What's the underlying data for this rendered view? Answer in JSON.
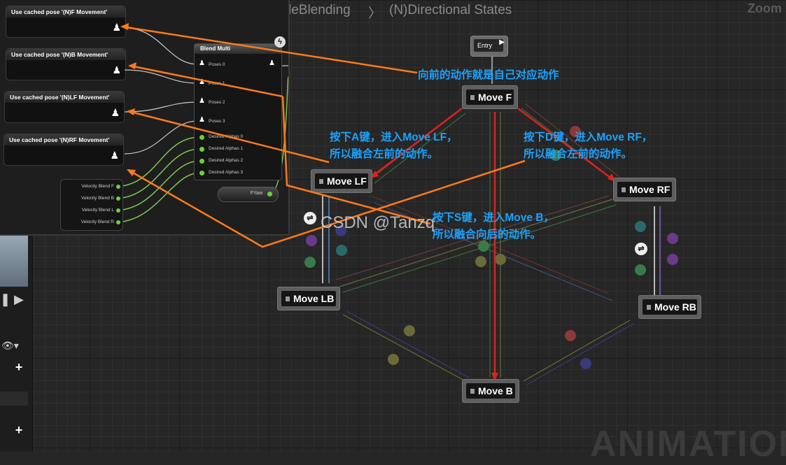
{
  "breadcrumb": {
    "parent": "leBlending",
    "separator": "〉",
    "current": "(N)Directional States",
    "zoom_label": "Zoom"
  },
  "background_watermark": "ANIMATION",
  "blend_panel": {
    "pose_nodes": [
      {
        "label": "Use cached pose '(N)F Movement'"
      },
      {
        "label": "Use cached pose '(N)B Movement'"
      },
      {
        "label": "Use cached pose '(N)LF Movement'"
      },
      {
        "label": "Use cached pose '(N)RF Movement'"
      }
    ],
    "blend_multi": {
      "title": "Blend Multi",
      "poses": [
        "Poses 0",
        "Poses 1",
        "Poses 2",
        "Poses 3"
      ],
      "alphas": [
        "Desired Alphas 0",
        "Desired Alphas 1",
        "Desired Alphas 2",
        "Desired Alphas 3"
      ]
    },
    "velocity_node": {
      "rows": [
        "Velocity Blend F",
        "Velocity Blend B",
        "Velocity Blend L",
        "Velocity Blend R"
      ]
    },
    "fyaw_label": "FYaw"
  },
  "state_machine": {
    "entry_label": "Entry",
    "states": {
      "move_f": "Move F",
      "move_lf": "Move LF",
      "move_rf": "Move RF",
      "move_lb": "Move LB",
      "move_rb": "Move RB",
      "move_b": "Move B"
    }
  },
  "annotations": {
    "forward": "向前的动作就是自己对应动作",
    "a_key_line1": "按下A键，进入Move LF，",
    "a_key_line2": "所以融合左前的动作。",
    "d_key_line1": "按下D键，进入Move RF，",
    "d_key_line2": "所以融合左前的动作。",
    "s_key_line1": "按下S键，进入Move B，",
    "s_key_line2": "所以融合向后的动作。"
  },
  "watermark": "CSDN @Tanzq",
  "colors": {
    "annotation_text": "#1aa3ff",
    "annotation_arrow": "#ff7a1a",
    "active_transition": "#e02020",
    "wire_green": "#7ec850"
  }
}
